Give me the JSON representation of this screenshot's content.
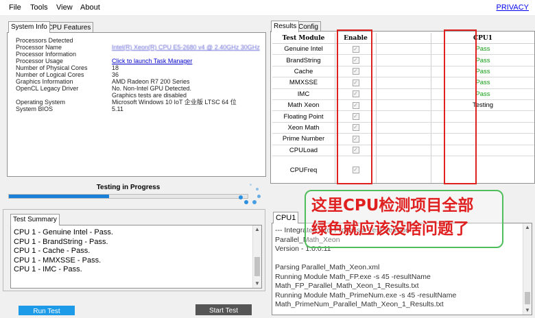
{
  "menu": {
    "file": "File",
    "tools": "Tools",
    "view": "View",
    "about": "About",
    "privacy": "PRIVACY"
  },
  "left_tabs": {
    "system_info": "System Info",
    "cpu_features": "CPU Features"
  },
  "system_info": [
    {
      "label": "Processors Detected",
      "value": ""
    },
    {
      "label": "Processor Name",
      "value": "Intel(R) Xeon(R) CPU E5-2680 v4 @ 2.40GHz  30GHz"
    },
    {
      "label": "Processor Information",
      "value": ""
    },
    {
      "label": "Processor Usage",
      "value": "Click to launch Task Manager"
    },
    {
      "label": "Number of Physical Cores",
      "value": "18"
    },
    {
      "label": "Number of Logical Cores",
      "value": "36"
    },
    {
      "label": "Graphics Information",
      "value": "AMD Radeon R7 200 Series"
    },
    {
      "label": "OpenCL Legacy Driver",
      "value": "No. Non-Intel GPU Detected."
    },
    {
      "label": "",
      "value": "Graphics tests are disabled"
    },
    {
      "label": "Operating System",
      "value": "Microsoft Windows 10 IoT 企业版 LTSC 64 位"
    },
    {
      "label": "System BIOS",
      "value": "5.11"
    }
  ],
  "right_tabs": {
    "results": "Results",
    "config": "Config"
  },
  "results_table": {
    "headers": {
      "module": "Test Module",
      "enable": "Enable",
      "cpu": "CPU1"
    },
    "rows": [
      {
        "module": "Genuine Intel",
        "enabled": true,
        "status": "Pass"
      },
      {
        "module": "BrandString",
        "enabled": true,
        "status": "Pass"
      },
      {
        "module": "Cache",
        "enabled": true,
        "status": "Pass"
      },
      {
        "module": "MMXSSE",
        "enabled": true,
        "status": "Pass"
      },
      {
        "module": "IMC",
        "enabled": true,
        "status": "Pass"
      },
      {
        "module": "Math Xeon",
        "enabled": true,
        "status": "Testing"
      },
      {
        "module": "Floating Point",
        "enabled": true,
        "status": ""
      },
      {
        "module": "Xeon Math",
        "enabled": true,
        "status": ""
      },
      {
        "module": "Prime Number",
        "enabled": true,
        "status": ""
      },
      {
        "module": "CPULoad",
        "enabled": true,
        "status": ""
      },
      {
        "module": "CPUFreq",
        "enabled": true,
        "status": ""
      }
    ],
    "pass_color": "#119e11",
    "testing_color": "#000000"
  },
  "progress": {
    "label": "Testing in Progress",
    "fraction": 0.42,
    "fill_color": "#1a7fd6"
  },
  "test_summary": {
    "tab": "Test Summary",
    "lines": [
      "CPU 1 - Genuine Intel - Pass.",
      "CPU 1 - BrandString - Pass.",
      "CPU 1 - Cache - Pass.",
      "CPU 1 - MMXSSE - Pass.",
      "CPU 1 - IMC - Pass."
    ]
  },
  "cpu_log": {
    "tab": "CPU1",
    "lines": [
      "--- Integrated Intel Processor Test Session",
      "Parallel_Math_Xeon",
      "Version - 1.0.0.11",
      "",
      "Parsing Parallel_Math_Xeon.xml",
      "Running Module Math_FP.exe -s 45 -resultName",
      "Math_FP_Parallel_Math_Xeon_1_Results.txt",
      "Running Module Math_PrimeNum.exe -s 45 -resultName",
      "Math_PrimeNum_Parallel_Math_Xeon_1_Results.txt"
    ]
  },
  "buttons": {
    "run_test": "Run Test",
    "start_test": "Start Test"
  },
  "annotation": {
    "line1": "这里CPU检测项目全部",
    "line2": "绿色就应该没啥问题了",
    "text_color": "#e02020",
    "border_color": "#4fbe5a",
    "highlight_color": "#e0201e"
  }
}
